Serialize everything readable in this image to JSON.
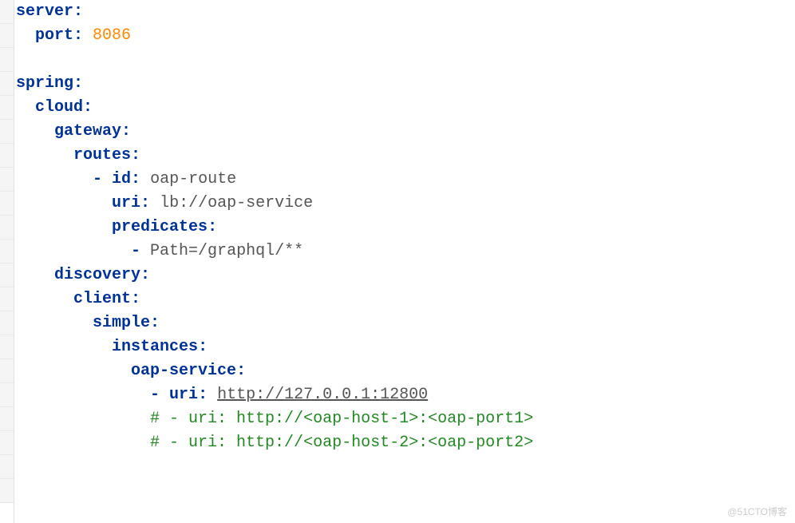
{
  "lines": [
    {
      "indent": "",
      "parts": [
        {
          "cls": "key",
          "text": "server"
        },
        {
          "cls": "key",
          "text": ":"
        }
      ]
    },
    {
      "indent": "  ",
      "parts": [
        {
          "cls": "key",
          "text": "port"
        },
        {
          "cls": "key",
          "text": ": "
        },
        {
          "cls": "number",
          "text": "8086"
        }
      ]
    },
    {
      "indent": "",
      "parts": []
    },
    {
      "indent": "",
      "parts": [
        {
          "cls": "key",
          "text": "spring"
        },
        {
          "cls": "key",
          "text": ":"
        }
      ]
    },
    {
      "indent": "  ",
      "parts": [
        {
          "cls": "key",
          "text": "cloud"
        },
        {
          "cls": "key",
          "text": ":"
        }
      ]
    },
    {
      "indent": "    ",
      "parts": [
        {
          "cls": "key",
          "text": "gateway"
        },
        {
          "cls": "key",
          "text": ":"
        }
      ]
    },
    {
      "indent": "      ",
      "parts": [
        {
          "cls": "key",
          "text": "routes"
        },
        {
          "cls": "key",
          "text": ":"
        }
      ]
    },
    {
      "indent": "        ",
      "parts": [
        {
          "cls": "dash",
          "text": "- "
        },
        {
          "cls": "key",
          "text": "id"
        },
        {
          "cls": "key",
          "text": ": "
        },
        {
          "cls": "value",
          "text": "oap-route"
        }
      ]
    },
    {
      "indent": "          ",
      "parts": [
        {
          "cls": "key",
          "text": "uri"
        },
        {
          "cls": "key",
          "text": ": "
        },
        {
          "cls": "value",
          "text": "lb://oap-service"
        }
      ]
    },
    {
      "indent": "          ",
      "parts": [
        {
          "cls": "key",
          "text": "predicates"
        },
        {
          "cls": "key",
          "text": ":"
        }
      ]
    },
    {
      "indent": "            ",
      "parts": [
        {
          "cls": "dash",
          "text": "- "
        },
        {
          "cls": "value",
          "text": "Path=/graphql/**"
        }
      ]
    },
    {
      "indent": "    ",
      "parts": [
        {
          "cls": "key",
          "text": "discovery"
        },
        {
          "cls": "key",
          "text": ":"
        }
      ]
    },
    {
      "indent": "      ",
      "parts": [
        {
          "cls": "key",
          "text": "client"
        },
        {
          "cls": "key",
          "text": ":"
        }
      ]
    },
    {
      "indent": "        ",
      "parts": [
        {
          "cls": "key",
          "text": "simple"
        },
        {
          "cls": "key",
          "text": ":"
        }
      ]
    },
    {
      "indent": "          ",
      "parts": [
        {
          "cls": "key",
          "text": "instances"
        },
        {
          "cls": "key",
          "text": ":"
        }
      ]
    },
    {
      "indent": "            ",
      "parts": [
        {
          "cls": "key",
          "text": "oap-service"
        },
        {
          "cls": "key",
          "text": ":"
        }
      ]
    },
    {
      "indent": "              ",
      "parts": [
        {
          "cls": "dash",
          "text": "- "
        },
        {
          "cls": "key",
          "text": "uri"
        },
        {
          "cls": "key",
          "text": ": "
        },
        {
          "cls": "value underline",
          "text": "http://127.0.0.1:12800"
        }
      ]
    },
    {
      "indent": "              ",
      "parts": [
        {
          "cls": "comment",
          "text": "# - uri: http://<oap-host-1>:<oap-port1>"
        }
      ]
    },
    {
      "indent": "              ",
      "parts": [
        {
          "cls": "comment",
          "text": "# - uri: http://<oap-host-2>:<oap-port2>"
        }
      ]
    }
  ],
  "watermark": "@51CTO博客"
}
